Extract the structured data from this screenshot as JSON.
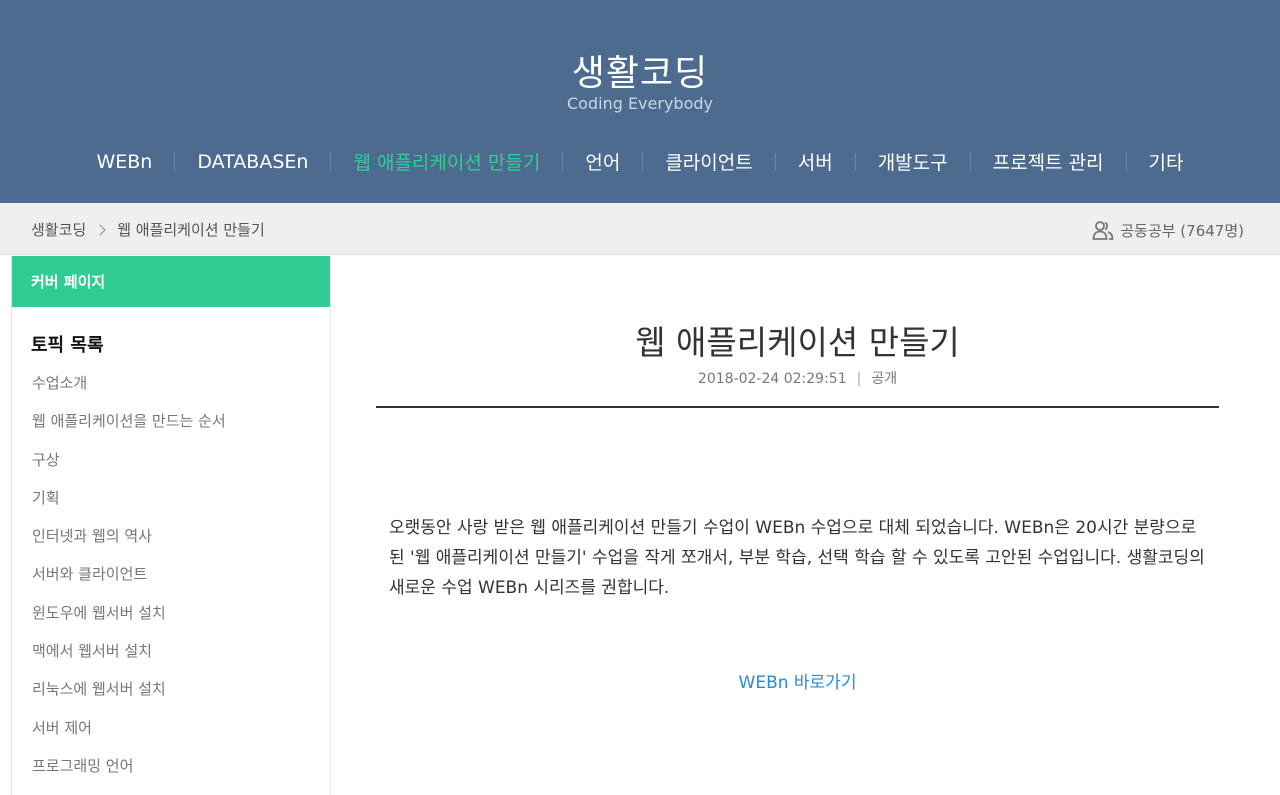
{
  "header": {
    "title": "생활코딩",
    "subtitle": "Coding Everybody",
    "nav": [
      {
        "label": "WEBn",
        "active": false
      },
      {
        "label": "DATABASEn",
        "active": false
      },
      {
        "label": "웹 애플리케이션 만들기",
        "active": true
      },
      {
        "label": "언어",
        "active": false
      },
      {
        "label": "클라이언트",
        "active": false
      },
      {
        "label": "서버",
        "active": false
      },
      {
        "label": "개발도구",
        "active": false
      },
      {
        "label": "프로젝트 관리",
        "active": false
      },
      {
        "label": "기타",
        "active": false
      }
    ]
  },
  "breadcrumb": {
    "home": "생활코딩",
    "current": "웹 애플리케이션 만들기"
  },
  "study": {
    "icon": "users-icon",
    "label": "공동공부 (7647명)"
  },
  "sidebar": {
    "cover_label": "커버 페이지",
    "toc_title": "토픽 목록",
    "items": [
      "수업소개",
      "웹 애플리케이션을 만드는 순서",
      "구상",
      "기획",
      "인터넷과 웹의 역사",
      "서버와 클라이언트",
      "윈도우에 웹서버 설치",
      "맥에서 웹서버 설치",
      "리눅스에 웹서버 설치",
      "서버 제어",
      "프로그래밍 언어"
    ]
  },
  "article": {
    "title": "웹 애플리케이션 만들기",
    "date": "2018-02-24 02:29:51",
    "visibility": "공개",
    "line1": "오랫동안 사랑 받은 웹 애플리케이션 만들기 수업이 WEBn 수업으로 대체 되었습니다. WEBn은 20시간 분량으로",
    "line2": "된 '웹 애플리케이션 만들기' 수업을 작게 쪼개서, 부분 학습, 선택 학습 할 수 있도록 고안된 수업입니다. 생활코딩의",
    "line3": "새로운 수업 WEBn 시리즈를 권합니다.",
    "link_label": "WEBn 바로가기"
  },
  "colors": {
    "header_bg": "#4d6b8f",
    "accent": "#2fcd93",
    "link": "#2a8ad6"
  }
}
